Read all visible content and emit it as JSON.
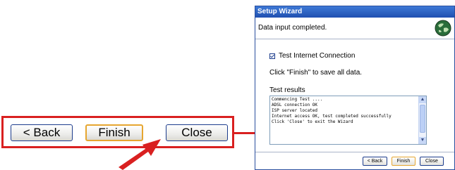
{
  "zoom": {
    "back_label": "< Back",
    "finish_label": "Finish",
    "close_label": "Close"
  },
  "wizard": {
    "title": "Setup Wizard",
    "header_text": "Data input completed.",
    "checkbox_label": "Test Internet Connection",
    "checkbox_checked": true,
    "save_message": "Click \"Finish\" to save all data.",
    "results_label": "Test results",
    "results_lines": "Commencing Test ....\nADSL connection OK\nISP server located\nInternet access OK, test completed successfully\nClick 'Close' to exit the Wizard",
    "buttons": {
      "back": "< Back",
      "finish": "Finish",
      "close": "Close"
    }
  },
  "colors": {
    "annotation": "#d92020",
    "titlebar": "#1f4fb0",
    "default_button_border": "#e6a630"
  },
  "icons": {
    "header": "globe-icon",
    "annotation": "red-arrow-icon",
    "checkbox": "checkmark-icon"
  }
}
